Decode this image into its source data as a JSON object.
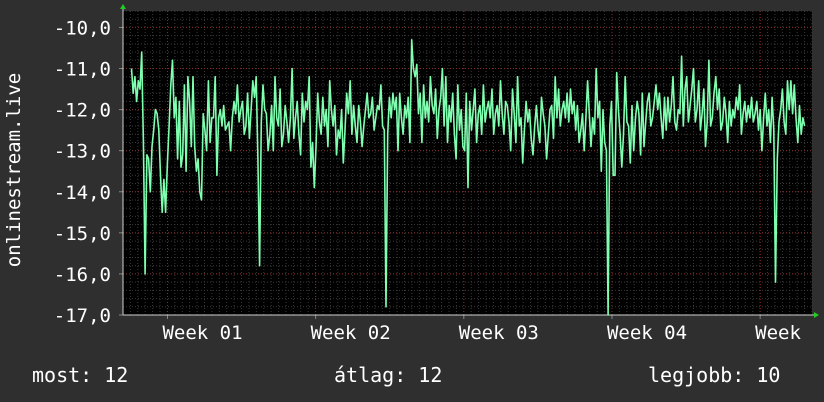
{
  "chart_data": {
    "type": "line",
    "ylabel": "onlinestream.live",
    "y_ticks": [
      "-10,0",
      "-11,0",
      "-12,0",
      "-13,0",
      "-14,0",
      "-15,0",
      "-16,0",
      "-17,0"
    ],
    "y_tick_values": [
      -10,
      -11,
      -12,
      -13,
      -14,
      -15,
      -16,
      -17
    ],
    "ylim": [
      -17,
      -9.6
    ],
    "x_ticks": [
      "Week 01",
      "Week 02",
      "Week 03",
      "Week 04",
      "Week"
    ],
    "x_tick_positions": [
      1,
      2,
      3,
      4,
      5
    ],
    "xlim": [
      0.7,
      5.35
    ],
    "grid": true,
    "line_color": "#7fffb0",
    "background_color": "#000000",
    "series": [
      {
        "values": [
          -11.0,
          -11.6,
          -11.2,
          -11.8,
          -11.3,
          -11.5,
          -10.6,
          -12.8,
          -16.0,
          -13.1,
          -13.2,
          -14.0,
          -12.9,
          -12.5,
          -12.0,
          -12.1,
          -12.5,
          -13.6,
          -14.5,
          -13.7,
          -14.5,
          -13.3,
          -12.4,
          -11.4,
          -10.8,
          -12.2,
          -11.7,
          -13.2,
          -11.8,
          -13.4,
          -13.1,
          -11.4,
          -13.5,
          -11.2,
          -11.8,
          -12.9,
          -11.2,
          -12.9,
          -13.5,
          -13.2,
          -14.0,
          -14.2,
          -12.1,
          -12.5,
          -13.0,
          -11.3,
          -12.8,
          -12.2,
          -12.2,
          -11.2,
          -13.6,
          -12.2,
          -12.0,
          -12.4,
          -11.9,
          -12.5,
          -12.4,
          -12.3,
          -13.0,
          -12.2,
          -11.8,
          -12.1,
          -11.4,
          -12.3,
          -12.0,
          -11.8,
          -12.6,
          -12.4,
          -11.6,
          -12.7,
          -12.0,
          -11.3,
          -11.7,
          -11.2,
          -13.2,
          -15.8,
          -12.3,
          -11.4,
          -12.0,
          -12.1,
          -13.0,
          -12.6,
          -11.9,
          -13.0,
          -11.2,
          -12.2,
          -12.4,
          -11.5,
          -12.9,
          -12.6,
          -11.9,
          -12.3,
          -12.8,
          -12.2,
          -11.0,
          -12.7,
          -12.2,
          -11.8,
          -12.6,
          -13.1,
          -11.6,
          -12.3,
          -11.8,
          -12.0,
          -11.2,
          -13.4,
          -12.8,
          -13.9,
          -12.9,
          -11.6,
          -12.3,
          -12.6,
          -11.7,
          -12.4,
          -12.0,
          -12.9,
          -11.3,
          -12.0,
          -12.4,
          -11.9,
          -13.1,
          -12.5,
          -12.7,
          -12.0,
          -13.3,
          -12.5,
          -11.6,
          -12.1,
          -11.3,
          -12.6,
          -11.9,
          -12.4,
          -12.8,
          -11.9,
          -12.3,
          -12.9,
          -12.4,
          -12.0,
          -11.6,
          -12.2,
          -12.1,
          -11.7,
          -12.5,
          -12.2,
          -11.9,
          -12.0,
          -11.4,
          -12.4,
          -12.5,
          -16.8,
          -12.6,
          -11.7,
          -12.2,
          -11.6,
          -12.0,
          -11.7,
          -13.0,
          -11.6,
          -12.2,
          -12.6,
          -11.9,
          -12.2,
          -11.7,
          -12.8,
          -10.3,
          -11.0,
          -11.2,
          -10.9,
          -12.1,
          -11.6,
          -12.8,
          -11.4,
          -12.2,
          -11.8,
          -12.3,
          -11.2,
          -11.9,
          -12.1,
          -11.5,
          -12.7,
          -12.0,
          -11.7,
          -11.0,
          -12.4,
          -11.2,
          -12.8,
          -11.9,
          -12.3,
          -11.6,
          -12.6,
          -13.2,
          -11.4,
          -12.5,
          -12.0,
          -12.9,
          -13.0,
          -11.6,
          -13.9,
          -11.8,
          -12.5,
          -12.0,
          -11.5,
          -12.8,
          -12.1,
          -11.9,
          -12.6,
          -11.4,
          -12.3,
          -12.0,
          -11.8,
          -12.2,
          -11.5,
          -12.6,
          -12.1,
          -11.9,
          -12.4,
          -11.3,
          -12.1,
          -12.6,
          -11.8,
          -11.9,
          -12.3,
          -13.0,
          -11.5,
          -12.1,
          -12.8,
          -11.2,
          -12.4,
          -12.2,
          -13.3,
          -12.5,
          -11.8,
          -12.3,
          -12.0,
          -12.7,
          -13.1,
          -12.4,
          -11.9,
          -12.5,
          -12.8,
          -11.7,
          -12.1,
          -12.4,
          -13.2,
          -12.6,
          -12.0,
          -11.9,
          -12.7,
          -11.2,
          -12.2,
          -11.5,
          -12.4,
          -12.0,
          -11.8,
          -12.2,
          -11.6,
          -12.3,
          -11.5,
          -12.1,
          -11.8,
          -12.5,
          -11.9,
          -12.8,
          -12.5,
          -12.1,
          -13.0,
          -12.2,
          -11.3,
          -12.1,
          -12.9,
          -12.2,
          -12.6,
          -11.0,
          -12.2,
          -11.8,
          -13.5,
          -12.0,
          -12.8,
          -13.0,
          -17.0,
          -12.4,
          -11.8,
          -13.6,
          -13.6,
          -11.1,
          -12.0,
          -12.6,
          -13.4,
          -12.6,
          -11.2,
          -12.3,
          -12.4,
          -13.3,
          -11.9,
          -13.0,
          -12.2,
          -11.8,
          -12.1,
          -13.1,
          -11.6,
          -12.9,
          -12.3,
          -11.8,
          -11.6,
          -12.4,
          -12.2,
          -11.8,
          -11.4,
          -12.0,
          -11.6,
          -12.2,
          -12.7,
          -11.7,
          -12.5,
          -11.7,
          -12.3,
          -11.9,
          -11.2,
          -12.3,
          -12.5,
          -12.0,
          -12.1,
          -10.7,
          -12.4,
          -11.5,
          -11.2,
          -12.3,
          -11.9,
          -11.5,
          -11.0,
          -12.3,
          -12.0,
          -11.3,
          -12.5,
          -12.1,
          -11.5,
          -12.9,
          -12.3,
          -10.8,
          -12.4,
          -12.2,
          -11.6,
          -11.2,
          -12.0,
          -11.5,
          -12.5,
          -12.3,
          -11.7,
          -12.1,
          -12.8,
          -11.8,
          -12.4,
          -12.0,
          -12.2,
          -11.7,
          -12.0,
          -11.4,
          -12.6,
          -12.1,
          -11.8,
          -12.3,
          -11.9,
          -12.2,
          -11.7,
          -12.3,
          -12.1,
          -11.8,
          -12.5,
          -12.0,
          -13.0,
          -12.2,
          -11.6,
          -12.4,
          -12.0,
          -12.8,
          -11.7,
          -12.5,
          -16.2,
          -13.2,
          -12.3,
          -12.0,
          -11.5,
          -12.3,
          -12.6,
          -11.3,
          -12.0,
          -11.3,
          -12.1,
          -11.4,
          -12.2,
          -12.8,
          -11.9,
          -12.6,
          -12.2,
          -12.4
        ]
      }
    ]
  },
  "stats": {
    "now": "most: 12",
    "avg": "átlag: 12",
    "max": "legjobb: 10"
  }
}
